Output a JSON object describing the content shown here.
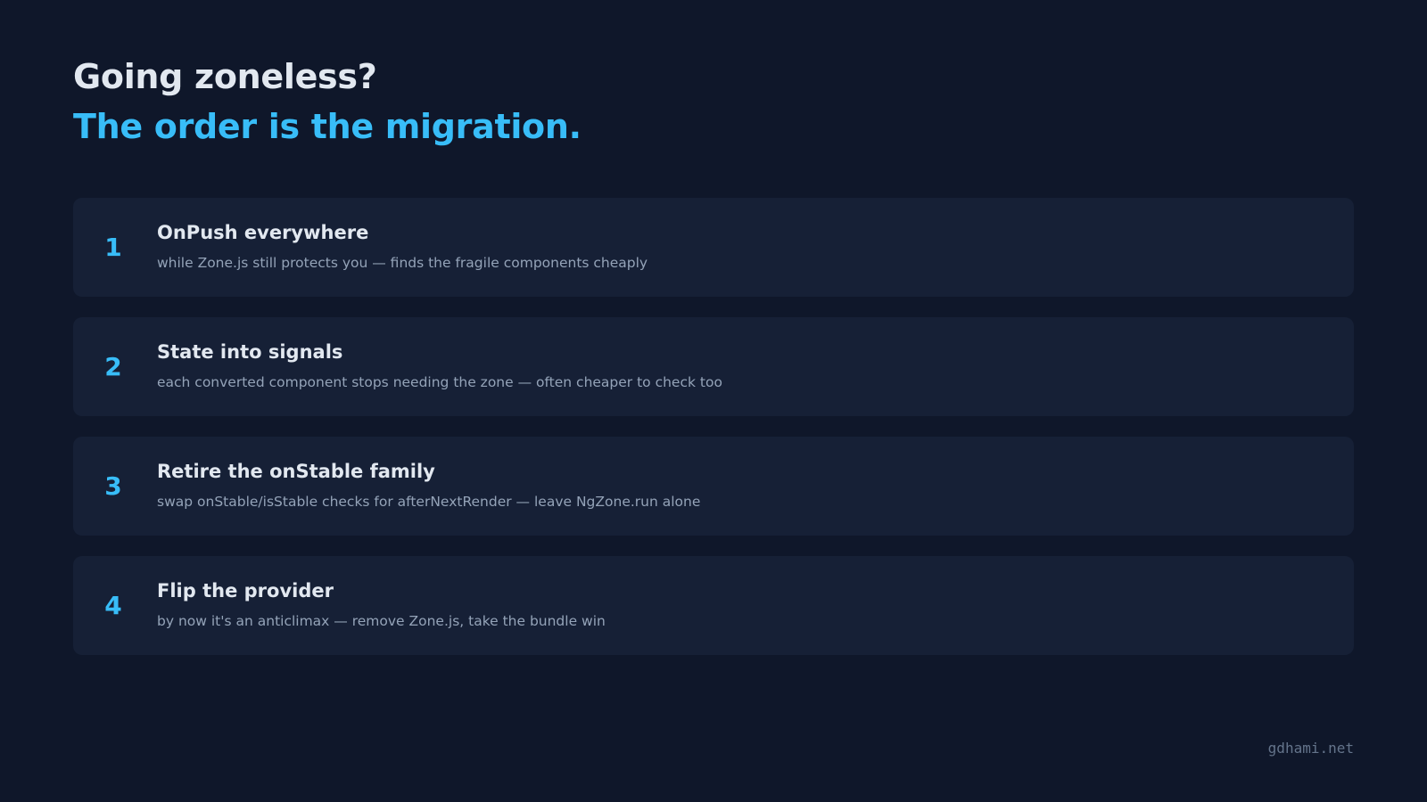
{
  "header": {
    "title": "Going zoneless?",
    "subtitle": "The order is the migration."
  },
  "steps": [
    {
      "number": "1",
      "title": "OnPush everywhere",
      "description": "while Zone.js still protects you — finds the fragile components cheaply"
    },
    {
      "number": "2",
      "title": "State into signals",
      "description": "each converted component stops needing the zone — often cheaper to check too"
    },
    {
      "number": "3",
      "title": "Retire the onStable family",
      "description": "swap onStable/isStable checks for afterNextRender — leave NgZone.run alone"
    },
    {
      "number": "4",
      "title": "Flip the provider",
      "description": "by now it's an anticlimax — remove Zone.js, take the bundle win"
    }
  ],
  "footer": {
    "site": "gdhami.net"
  },
  "colors": {
    "background": "#0f172a",
    "card": "#162036",
    "accent": "#38bdf8",
    "heading": "#e2e8f0",
    "muted": "#94a3b8",
    "footer": "#64748b"
  }
}
